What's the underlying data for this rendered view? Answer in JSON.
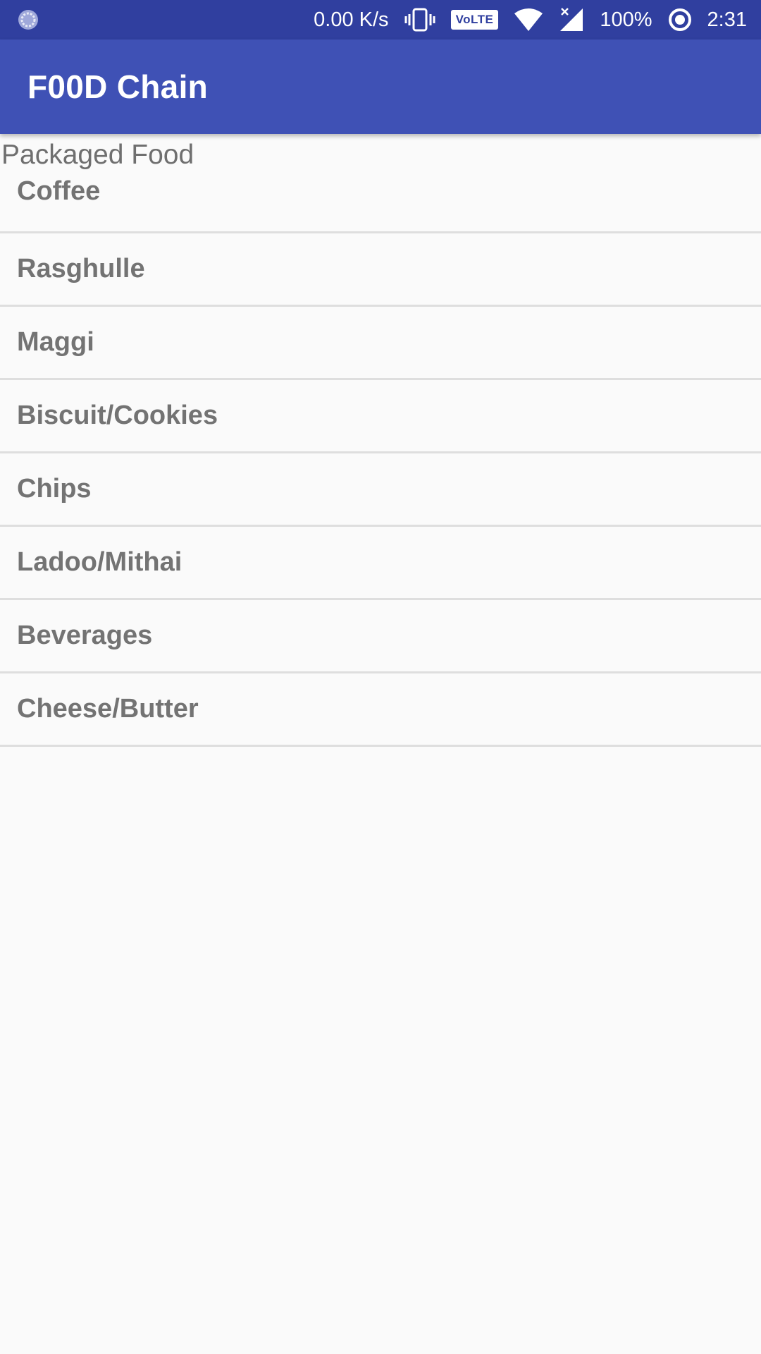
{
  "status_bar": {
    "notification_icon": "app-notification-icon",
    "network_speed": "0.00 K/s",
    "vibrate_icon": "vibrate-icon",
    "volte_label": "VoLTE",
    "wifi_icon": "wifi-icon",
    "signal_icon": "signal-icon",
    "battery": "100%",
    "sync_icon": "circle-status-icon",
    "time": "2:31"
  },
  "app_bar": {
    "title": "F00D Chain",
    "color": "#3f51b5"
  },
  "main": {
    "section_title": "Packaged Food",
    "items": [
      {
        "label": "Coffee"
      },
      {
        "label": "Rasghulle"
      },
      {
        "label": "Maggi"
      },
      {
        "label": "Biscuit/Cookies"
      },
      {
        "label": "Chips"
      },
      {
        "label": "Ladoo/Mithai"
      },
      {
        "label": "Beverages"
      },
      {
        "label": "Cheese/Butter"
      }
    ]
  }
}
